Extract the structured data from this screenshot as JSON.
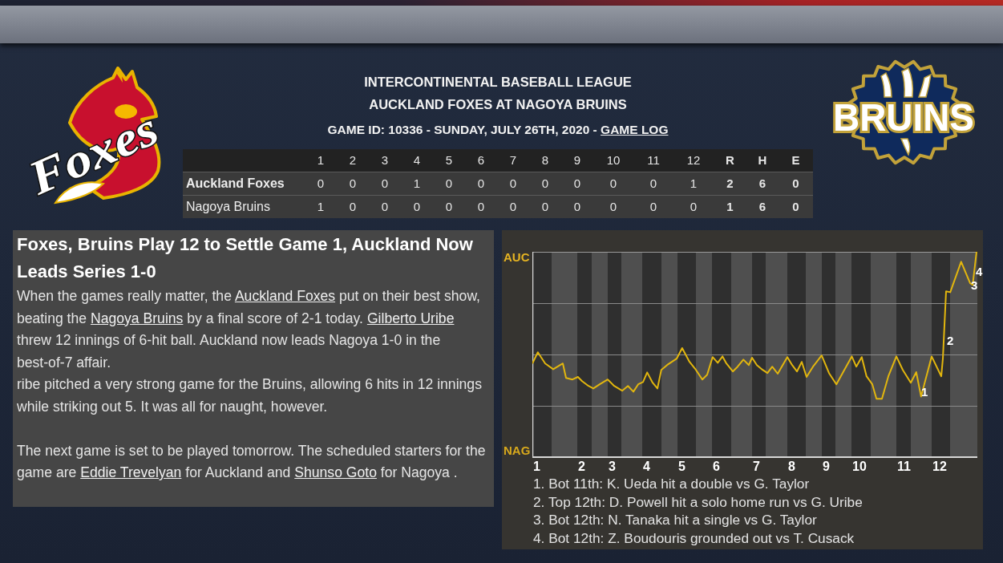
{
  "header": {
    "away_logo": {
      "text": "Foxes"
    },
    "league": "INTERCONTINENTAL BASEBALL LEAGUE",
    "matchup": "AUCKLAND FOXES AT NAGOYA BRUINS",
    "game_info": "GAME ID: 10336 - SUNDAY, JULY 26TH, 2020 - ",
    "game_log_link": "GAME LOG",
    "home_logo": {
      "text": "BRUINS"
    }
  },
  "line_score": {
    "columns": [
      {
        "label": "1",
        "kind": "inning"
      },
      {
        "label": "2",
        "kind": "inning"
      },
      {
        "label": "3",
        "kind": "inning"
      },
      {
        "label": "4",
        "kind": "inning"
      },
      {
        "label": "5",
        "kind": "inning"
      },
      {
        "label": "6",
        "kind": "inning"
      },
      {
        "label": "7",
        "kind": "inning"
      },
      {
        "label": "8",
        "kind": "inning"
      },
      {
        "label": "9",
        "kind": "inning"
      },
      {
        "label": "10",
        "kind": "inning"
      },
      {
        "label": "11",
        "kind": "inning"
      },
      {
        "label": "12",
        "kind": "inning"
      },
      {
        "label": "R",
        "kind": "total"
      },
      {
        "label": "H",
        "kind": "total"
      },
      {
        "label": "E",
        "kind": "total"
      }
    ],
    "rows": [
      {
        "team": "Auckland Foxes",
        "winner": true,
        "cells": [
          "0",
          "0",
          "0",
          "1",
          "0",
          "0",
          "0",
          "0",
          "0",
          "0",
          "0",
          "1",
          "2",
          "6",
          "0"
        ]
      },
      {
        "team": "Nagoya Bruins",
        "winner": false,
        "cells": [
          "1",
          "0",
          "0",
          "0",
          "0",
          "0",
          "0",
          "0",
          "0",
          "0",
          "0",
          "0",
          "1",
          "6",
          "0"
        ]
      }
    ]
  },
  "article": {
    "headline": "Foxes, Bruins Play 12 to Settle Game 1, Auckland Now Leads Series 1-0",
    "sections": [
      {
        "paragraphs": [
          {
            "segments": [
              {
                "kind": "plain",
                "text": "When the games really matter, the "
              },
              {
                "kind": "link",
                "text": "Auckland Foxes"
              },
              {
                "kind": "plain",
                "text": " put on their best show, beating the "
              },
              {
                "kind": "link",
                "text": "Nagoya Bruins"
              },
              {
                "kind": "plain",
                "text": " by a final score of 2-1 today. "
              },
              {
                "kind": "link",
                "text": "Gilberto Uribe"
              },
              {
                "kind": "plain",
                "text": " threw 12 innings of 6-hit ball. Auckland now leads Nagoya 1-0 in the best-of-7 affair."
              }
            ]
          },
          {
            "segments": [
              {
                "kind": "plain",
                "text": "ribe pitched a very strong game for the Bruins, allowing 6 hits in 12 innings while striking out 5. It was all for naught, however."
              }
            ]
          }
        ]
      },
      {
        "paragraphs": [
          {
            "segments": [
              {
                "kind": "plain",
                "text": "The next game is set to be played tomorrow. The scheduled starters for the game are "
              },
              {
                "kind": "link",
                "text": "Eddie Trevelyan"
              },
              {
                "kind": "plain",
                "text": " for Auckland and "
              },
              {
                "kind": "link",
                "text": "Shunso Goto"
              },
              {
                "kind": "plain",
                "text": " for Nagoya ."
              }
            ]
          }
        ]
      }
    ]
  },
  "win_chart": {
    "top_label": "AUC",
    "bottom_label": "NAG",
    "innings": [
      "1",
      "2",
      "3",
      "4",
      "5",
      "6",
      "7",
      "8",
      "9",
      "10",
      "11",
      "12"
    ],
    "markers": [
      "1",
      "2",
      "3",
      "4"
    ],
    "events": [
      "1. Bot 11th: K. Ueda hit a double vs G. Taylor",
      "2. Top 12th: D. Powell hit a solo home run vs G. Uribe",
      "3. Bot 12th: N. Tanaka hit a single vs G. Taylor",
      "4. Bot 12th: Z. Boudouris grounded out vs T. Cusack"
    ]
  }
}
